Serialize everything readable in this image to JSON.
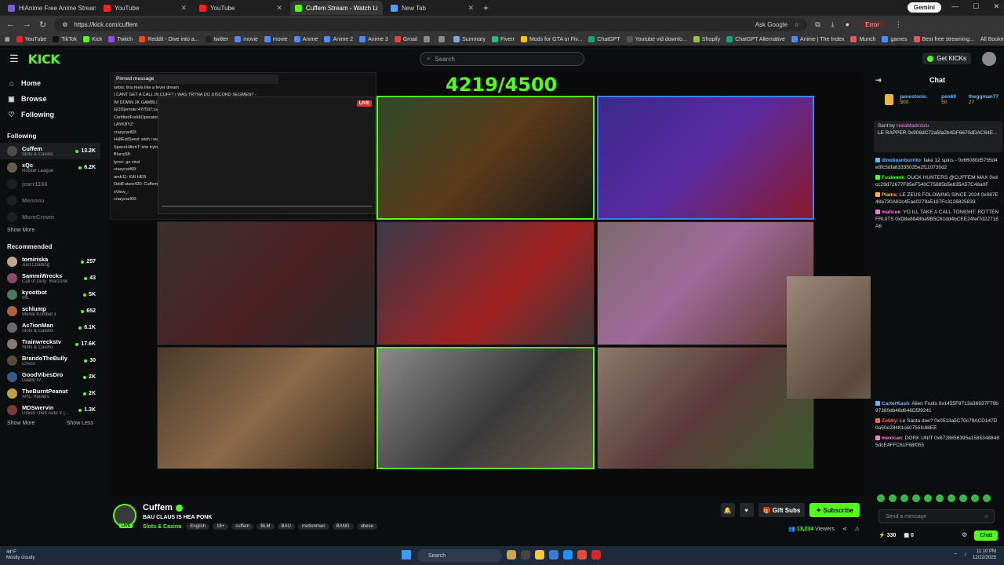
{
  "browser": {
    "tabs": [
      {
        "label": "HiAnime Free Anime Streaming",
        "color": "#7b5cd6",
        "active": false
      },
      {
        "label": "YouTube",
        "color": "#ff2020",
        "active": false
      },
      {
        "label": "YouTube",
        "color": "#ff2020",
        "active": false
      },
      {
        "label": "Cuffem Stream - Watch Li",
        "color": "#53fc18",
        "active": true
      },
      {
        "label": "New Tab",
        "color": "#4aa3ff",
        "active": false
      }
    ],
    "gemini_label": "Gemini",
    "url": "https://kick.com/cuffem",
    "ask_google": "Ask Google",
    "error_label": "Error",
    "bookmarks": [
      {
        "label": "YouTube",
        "color": "#ff2020"
      },
      {
        "label": "TikTok",
        "color": "#111111"
      },
      {
        "label": "Kick",
        "color": "#53fc18"
      },
      {
        "label": "Twitch",
        "color": "#9146ff"
      },
      {
        "label": "Reddit - Dive into a...",
        "color": "#ff4500"
      },
      {
        "label": "twitter",
        "color": "#222222"
      },
      {
        "label": "movie",
        "color": "#4a8cff"
      },
      {
        "label": "movie",
        "color": "#4a8cff"
      },
      {
        "label": "Anime",
        "color": "#4a8cff"
      },
      {
        "label": "Anime 2",
        "color": "#4a8cff"
      },
      {
        "label": "Anime 3",
        "color": "#4a8cff"
      },
      {
        "label": "Gmail",
        "color": "#ea4335"
      },
      {
        "label": "",
        "color": "#888888"
      },
      {
        "label": "",
        "color": "#888888"
      },
      {
        "label": "Summary",
        "color": "#7ad"
      },
      {
        "label": "Fiverr",
        "color": "#1dbf73"
      },
      {
        "label": "Mods for GTA or Fiv...",
        "color": "#ffc107"
      },
      {
        "label": "ChatGPT",
        "color": "#10a37f"
      },
      {
        "label": "Youtube vid downlo...",
        "color": "#555555"
      },
      {
        "label": "Shopify",
        "color": "#95bf47"
      },
      {
        "label": "ChatGPT Alternative",
        "color": "#10a37f"
      },
      {
        "label": "Anime | The Index",
        "color": "#4a8cff"
      },
      {
        "label": "Munch",
        "color": "#e05a5a"
      },
      {
        "label": "games",
        "color": "#4a8cff"
      },
      {
        "label": "Best free streaming...",
        "color": "#e05a5a"
      }
    ],
    "all_bookmarks": "All Bookmarks"
  },
  "kick": {
    "search_placeholder": "Search",
    "get_kicks": "Get KICKs"
  },
  "sidebar": {
    "nav": [
      {
        "label": "Home",
        "icon": "home-icon",
        "glyph": "⌂"
      },
      {
        "label": "Browse",
        "icon": "browse-icon",
        "glyph": "▣"
      },
      {
        "label": "Following",
        "icon": "heart-icon",
        "glyph": "♡"
      }
    ],
    "following_title": "Following",
    "following": [
      {
        "name": "Cuffem",
        "category": "Slots & Casino",
        "viewers": "13.2K",
        "color": "#4d4d4d",
        "online": true,
        "selected": true
      },
      {
        "name": "xQc",
        "category": "Rocket League",
        "viewers": "6.2K",
        "color": "#6b5a4a",
        "online": true
      },
      {
        "name": "jcarr1166",
        "category": "",
        "viewers": "",
        "color": "#333333",
        "online": false
      },
      {
        "name": "Menoou",
        "category": "",
        "viewers": "",
        "color": "#333333",
        "online": false
      },
      {
        "name": "MoreCrown",
        "category": "",
        "viewers": "",
        "color": "#333333",
        "online": false
      }
    ],
    "show_more": "Show More",
    "recommended_title": "Recommended",
    "recommended": [
      {
        "name": "tomiriska",
        "category": "Just Chatting",
        "viewers": "257",
        "color": "#c7a38a"
      },
      {
        "name": "SammiWrecks",
        "category": "Call of Duty: Warzone",
        "viewers": "43",
        "color": "#8f4a6a"
      },
      {
        "name": "kyootbot",
        "category": "IRL",
        "viewers": "5K",
        "color": "#4a7a5a"
      },
      {
        "name": "schlump",
        "category": "Mortal Kombat 1",
        "viewers": "652",
        "color": "#b06040"
      },
      {
        "name": "Ac7ionMan",
        "category": "Slots & Casino",
        "viewers": "6.1K",
        "color": "#6a6a6a"
      },
      {
        "name": "Trainwreckstv",
        "category": "Slots & Casino",
        "viewers": "17.6K",
        "color": "#8a7a6a"
      },
      {
        "name": "BrandoTheBully",
        "category": "Chess",
        "viewers": "30",
        "color": "#5a4a3a"
      },
      {
        "name": "GoodVibesDro",
        "category": "Diablo IV",
        "viewers": "2K",
        "color": "#3a5a8a"
      },
      {
        "name": "TheBurntPeanut",
        "category": "ARC Raiders",
        "viewers": "2K",
        "color": "#c0a040"
      },
      {
        "name": "MDSwervin",
        "category": "Grand Theft Auto V (...",
        "viewers": "1.3K",
        "color": "#7a3a3a"
      }
    ],
    "show_more2": "Show More",
    "show_less": "Show Less"
  },
  "player": {
    "counter": "4219/4500",
    "pinned_label": "Pinned message",
    "overlay_lines": [
      "sebis: this feels like a fever dream",
      "I CANT GET A CALL IN CUFF? I WAS TRYNA DO DISCORD SEGMENT -",
      "IM DOWN 2K GAMBLING THIS MONTH ON",
      "GOD[emote:477597:cuffemgreenbang]",
      "CertifiedFork6Operator",
      "LAYKBYZ:",
      "crazycarl69:",
      "HalfExitSeed: wish i was retarded and had millions",
      "SpaceHiltonT: she trying her hardest to hold back the hard r",
      "Blurry58:",
      "tyree: go viral",
      "crazycarl69:",
      "amb11: KAI HER",
      "OddFuture420: Cuffem made this call",
      "xView_:",
      "crazycarl69:"
    ],
    "live_label": "LIVE"
  },
  "stream": {
    "name": "Cuffem",
    "title": "BAU CLAUS IS HEA PONK",
    "category": "Slots & Casino",
    "tags": [
      "English",
      "18+",
      "cuffem",
      "BLM",
      "BAU",
      "motionman",
      "BANG",
      "obese"
    ],
    "live_label": "LIVE",
    "gift_subs": "Gift Subs",
    "subscribe": "Subscribe",
    "viewers": "13,234",
    "viewers_label": "Viewers"
  },
  "chat": {
    "title": "Chat",
    "leaders": [
      {
        "name": "jamestonic",
        "amount": "500"
      },
      {
        "name": "pen69",
        "amount": "50"
      },
      {
        "name": "theggman77",
        "amount": "27"
      }
    ],
    "sent_by_label": "Sent by",
    "sent_by_user": "HalaMadridslu",
    "sent_by_text": "LE RAPPER 0x906dC72a5fa2b4DF6670dDAC64E...",
    "messages": [
      {
        "user": "dinobeanburrito",
        "color": "#6ab7ff",
        "text": "fake 12 spins - 0x66080d5755d4e8fc5dfa83335035e2f110730d2"
      },
      {
        "user": "Fusionnk",
        "color": "#53fc18",
        "text": "DUCK HUNTERS @CUFFEM MAX 0xdcc29d72677F85eF540C75885b5e835A57C48a0F"
      },
      {
        "user": "Plains",
        "color": "#ffb347",
        "text": "LE ZEUS FOLOWING SINCE 2024 0x087E48a730A82c4Eae0279a5197Fc3126825833"
      },
      {
        "user": "malicee",
        "color": "#ff7ad9",
        "text": "YO ILL TAKE A CALL TONIGHT: ROTTEN FRUITS 0xD8e8848ba9B5C61dd4bCEE24fef7d22716A6"
      },
      {
        "user": "CarterKash",
        "color": "#6ab7ff",
        "text": "Alien Fruits 0x1455F8713a36937F79b97380db48d646D5f9241"
      },
      {
        "user": "Zobby",
        "color": "#ff6060",
        "text": "Le Santa due? 0x0513a5C70c79ACD147D0a50e28481c60755fc88EE"
      },
      {
        "user": "mexican",
        "color": "#ff7ad9",
        "text": "DORK UNIT 0x6728856395a15853488485dcE4FFC61F68f055"
      }
    ],
    "input_placeholder": "Send a message",
    "points": "330",
    "gift_count": "0",
    "chat_button": "Chat"
  },
  "taskbar": {
    "temp": "44°F",
    "weather": "Mostly cloudy",
    "search": "Search",
    "time": "11:10 PM",
    "date": "12/22/2025",
    "app_colors": [
      "#caa54a",
      "#444444",
      "#f4c542",
      "#3a7bd5",
      "#1e90ff",
      "#e34c3a",
      "#d62a2a"
    ]
  }
}
